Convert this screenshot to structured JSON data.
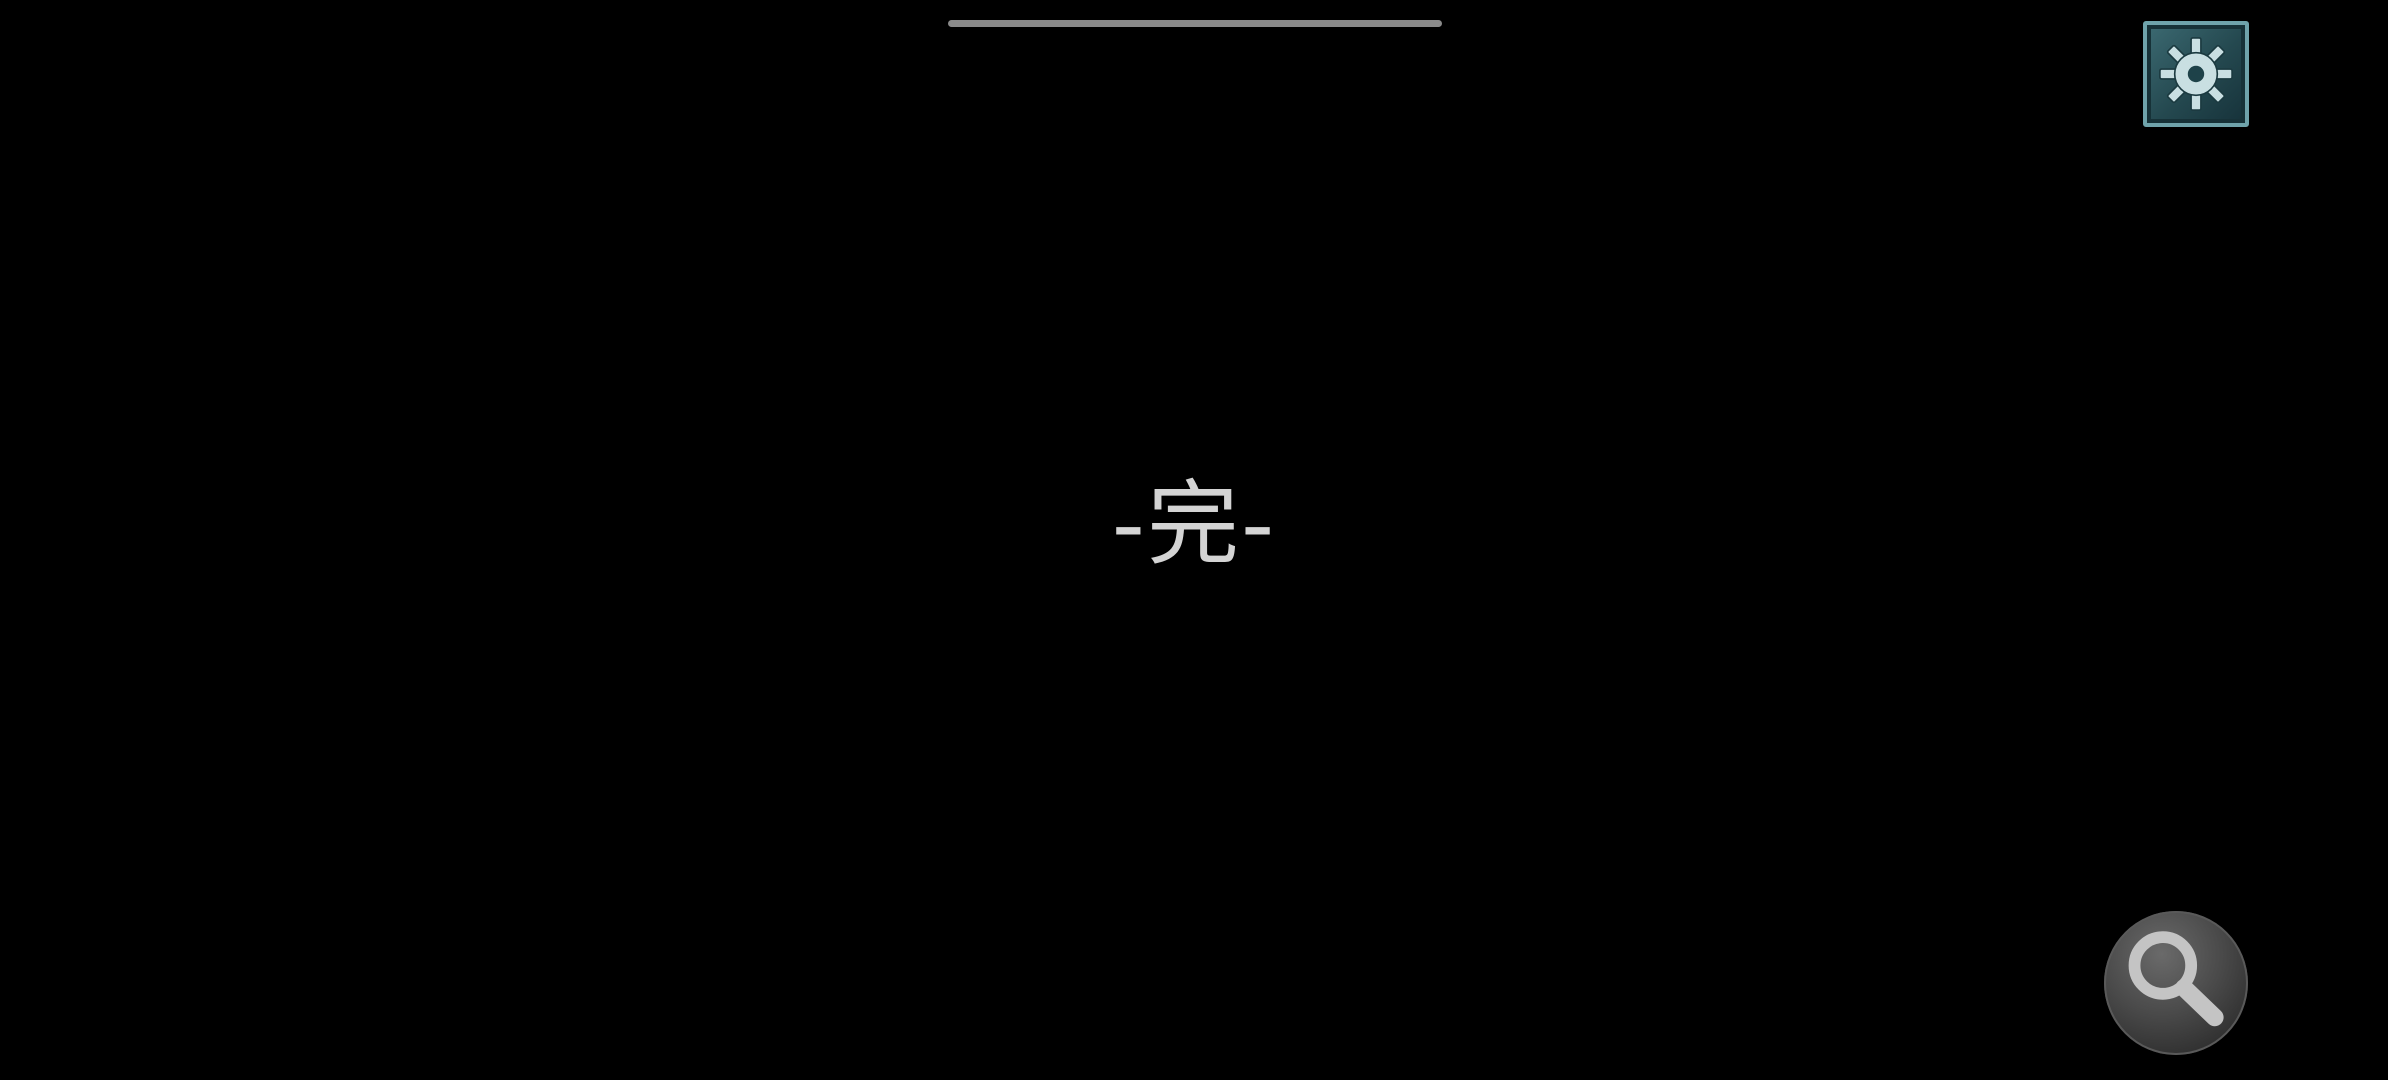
{
  "screen": {
    "background_color": "#000000"
  },
  "end_screen": {
    "text": "-完-",
    "text_color": "#d4d4d4"
  },
  "settings_button": {
    "icon": "gear-icon",
    "accent_color": "#3c6a72"
  },
  "search_button": {
    "icon": "magnifier-icon",
    "accent_color": "#4a4a4a"
  }
}
